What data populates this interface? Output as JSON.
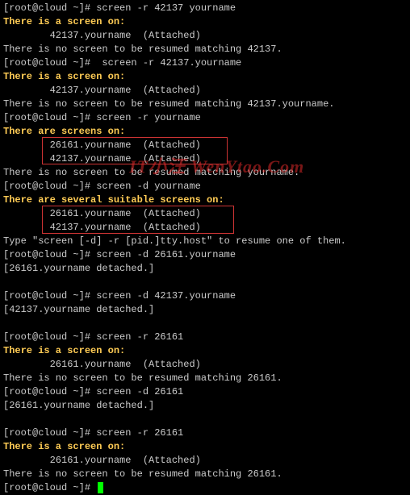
{
  "lines": [
    {
      "segs": [
        {
          "t": "[root@cloud ~]# ",
          "c": ""
        },
        {
          "t": "screen -r 42137 yourname",
          "c": ""
        }
      ]
    },
    {
      "segs": [
        {
          "t": "There is a screen on:",
          "c": "yellow"
        }
      ]
    },
    {
      "segs": [
        {
          "t": "        42137.yourname  (Attached)",
          "c": ""
        }
      ]
    },
    {
      "segs": [
        {
          "t": "There is no screen to be resumed matching 42137.",
          "c": ""
        }
      ]
    },
    {
      "segs": [
        {
          "t": "[root@cloud ~]#  screen -r 42137.yourname",
          "c": ""
        }
      ]
    },
    {
      "segs": [
        {
          "t": "There is a screen on:",
          "c": "yellow"
        }
      ]
    },
    {
      "segs": [
        {
          "t": "        42137.yourname  (Attached)",
          "c": ""
        }
      ]
    },
    {
      "segs": [
        {
          "t": "There is no screen to be resumed matching 42137.yourname.",
          "c": ""
        }
      ]
    },
    {
      "segs": [
        {
          "t": "[root@cloud ~]# screen -r yourname",
          "c": ""
        }
      ]
    },
    {
      "segs": [
        {
          "t": "There are screens on:",
          "c": "yellow"
        }
      ]
    },
    {
      "segs": [
        {
          "t": "        26161.yourname  (Attached)",
          "c": ""
        }
      ]
    },
    {
      "segs": [
        {
          "t": "        42137.yourname  (Attached)",
          "c": ""
        }
      ]
    },
    {
      "segs": [
        {
          "t": "There is no screen to be resumed matching yourname.",
          "c": ""
        }
      ]
    },
    {
      "segs": [
        {
          "t": "[root@cloud ~]# screen -d yourname",
          "c": ""
        }
      ]
    },
    {
      "segs": [
        {
          "t": "There are several suitable screens on:",
          "c": "yellow"
        }
      ]
    },
    {
      "segs": [
        {
          "t": "        26161.yourname  (Attached)",
          "c": ""
        }
      ]
    },
    {
      "segs": [
        {
          "t": "        42137.yourname  (Attached)",
          "c": ""
        }
      ]
    },
    {
      "segs": [
        {
          "t": "Type \"screen [-d] -r [pid.]tty.host\" to resume one of them.",
          "c": ""
        }
      ]
    },
    {
      "segs": [
        {
          "t": "[root@cloud ~]# screen -d 26161.yourname",
          "c": ""
        }
      ]
    },
    {
      "segs": [
        {
          "t": "[26161.yourname detached.]",
          "c": ""
        }
      ]
    },
    {
      "segs": [
        {
          "t": "",
          "c": ""
        }
      ]
    },
    {
      "segs": [
        {
          "t": "[root@cloud ~]# screen -d 42137.yourname",
          "c": ""
        }
      ]
    },
    {
      "segs": [
        {
          "t": "[42137.yourname detached.]",
          "c": ""
        }
      ]
    },
    {
      "segs": [
        {
          "t": "",
          "c": ""
        }
      ]
    },
    {
      "segs": [
        {
          "t": "[root@cloud ~]# screen -r 26161",
          "c": ""
        }
      ]
    },
    {
      "segs": [
        {
          "t": "There is a screen on:",
          "c": "yellow"
        }
      ]
    },
    {
      "segs": [
        {
          "t": "        26161.yourname  (Attached)",
          "c": ""
        }
      ]
    },
    {
      "segs": [
        {
          "t": "There is no screen to be resumed matching 26161.",
          "c": ""
        }
      ]
    },
    {
      "segs": [
        {
          "t": "[root@cloud ~]# screen -d 26161",
          "c": ""
        }
      ]
    },
    {
      "segs": [
        {
          "t": "[26161.yourname detached.]",
          "c": ""
        }
      ]
    },
    {
      "segs": [
        {
          "t": "",
          "c": ""
        }
      ]
    },
    {
      "segs": [
        {
          "t": "[root@cloud ~]# screen -r 26161",
          "c": ""
        }
      ]
    },
    {
      "segs": [
        {
          "t": "There is a screen on:",
          "c": "yellow"
        }
      ]
    },
    {
      "segs": [
        {
          "t": "        26161.yourname  (Attached)",
          "c": ""
        }
      ]
    },
    {
      "segs": [
        {
          "t": "There is no screen to be resumed matching 26161.",
          "c": ""
        }
      ]
    },
    {
      "segs": [
        {
          "t": "[root@cloud ~]# ",
          "c": "",
          "cursor": true
        }
      ]
    }
  ],
  "watermark": "IT小汪 WenYtao.Com"
}
